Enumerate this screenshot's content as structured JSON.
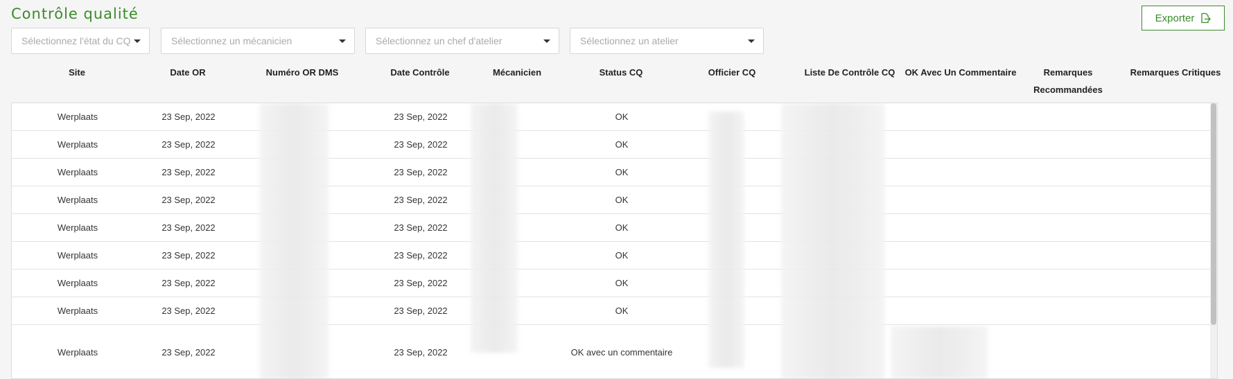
{
  "header": {
    "title": "Contrôle qualité",
    "export_label": "Exporter"
  },
  "filters": [
    {
      "placeholder": "Sélectionnez l'état du CQ"
    },
    {
      "placeholder": "Sélectionnez un mécanicien"
    },
    {
      "placeholder": "Sélectionnez un chef d'atelier"
    },
    {
      "placeholder": "Sélectionnez un atelier"
    }
  ],
  "columns": [
    "Site",
    "Date OR",
    "Numéro OR DMS",
    "Date Contrôle",
    "Mécanicien",
    "Status CQ",
    "Officier CQ",
    "Liste De Contrôle CQ",
    "OK Avec Un Commentaire",
    "Remarques Recommandées",
    "Remarques Critiques"
  ],
  "rows": [
    {
      "site": "Werplaats",
      "date_or": "23 Sep, 2022",
      "date_controle": "23 Sep, 2022",
      "status": "OK"
    },
    {
      "site": "Werplaats",
      "date_or": "23 Sep, 2022",
      "date_controle": "23 Sep, 2022",
      "status": "OK"
    },
    {
      "site": "Werplaats",
      "date_or": "23 Sep, 2022",
      "date_controle": "23 Sep, 2022",
      "status": "OK"
    },
    {
      "site": "Werplaats",
      "date_or": "23 Sep, 2022",
      "date_controle": "23 Sep, 2022",
      "status": "OK"
    },
    {
      "site": "Werplaats",
      "date_or": "23 Sep, 2022",
      "date_controle": "23 Sep, 2022",
      "status": "OK"
    },
    {
      "site": "Werplaats",
      "date_or": "23 Sep, 2022",
      "date_controle": "23 Sep, 2022",
      "status": "OK"
    },
    {
      "site": "Werplaats",
      "date_or": "23 Sep, 2022",
      "date_controle": "23 Sep, 2022",
      "status": "OK"
    },
    {
      "site": "Werplaats",
      "date_or": "23 Sep, 2022",
      "date_controle": "23 Sep, 2022",
      "status": "OK"
    },
    {
      "site": "Werplaats",
      "date_or": "23 Sep, 2022",
      "date_controle": "23 Sep, 2022",
      "status": "OK avec un commentaire"
    }
  ],
  "colors": {
    "accent": "#3a8b2b",
    "background": "#f5f5f5",
    "table_bg": "#ffffff"
  },
  "icons": {
    "export": "export-icon",
    "dropdown": "chevron-down-icon"
  }
}
